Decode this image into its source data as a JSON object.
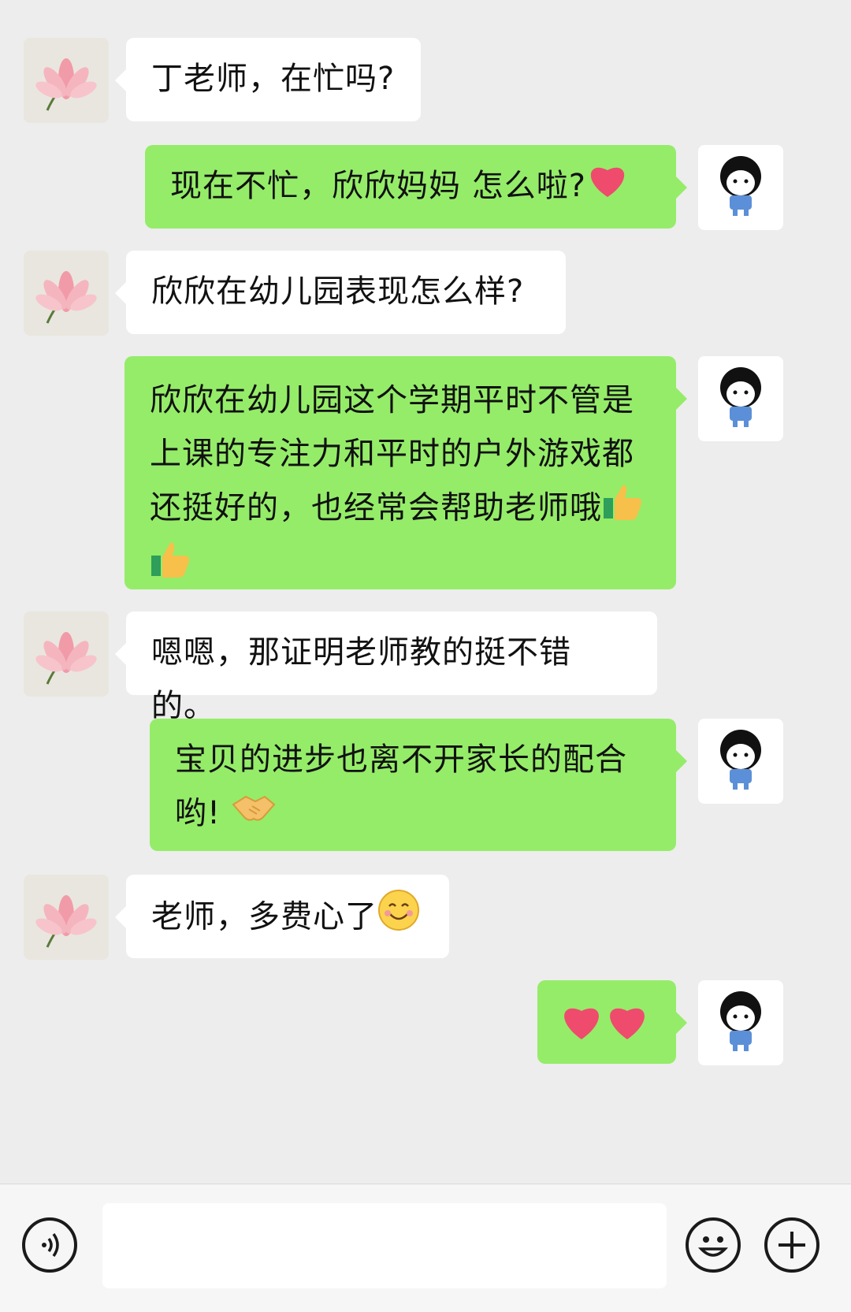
{
  "messages": [
    {
      "side": "in",
      "text": "丁老师，在忙吗?"
    },
    {
      "side": "out",
      "text": "现在不忙，欣欣妈妈 怎么啦?",
      "emoji": "heart-emoji"
    },
    {
      "side": "in",
      "text": "欣欣在幼儿园表现怎么样?"
    },
    {
      "side": "out",
      "lines": [
        "欣欣在幼儿园这个学期平时不管是",
        "上课的专注力和平时的户外游戏都",
        "还挺好的，也经常会帮助老师哦"
      ],
      "emoji": "thumbs-up-emoji"
    },
    {
      "side": "in",
      "text": "嗯嗯，那证明老师教的挺不错的。"
    },
    {
      "side": "out",
      "lines": [
        "宝贝的进步也离不开家长的配合",
        "哟!"
      ],
      "emoji": "handshake-emoji"
    },
    {
      "side": "in",
      "text": "老师，多费心了",
      "emoji": "smile-emoji"
    },
    {
      "side": "out",
      "text": "",
      "emoji": "two-hearts-emoji"
    }
  ],
  "avatars": {
    "incoming": "lotus-avatar",
    "outgoing": "cartoon-kid-avatar"
  },
  "input_bar": {
    "icons": [
      "voice-icon",
      "emoji-icon",
      "plus-icon"
    ],
    "input_value": ""
  },
  "colors": {
    "background": "#ededed",
    "incoming_bubble": "#ffffff",
    "outgoing_bubble": "#95ec69"
  }
}
